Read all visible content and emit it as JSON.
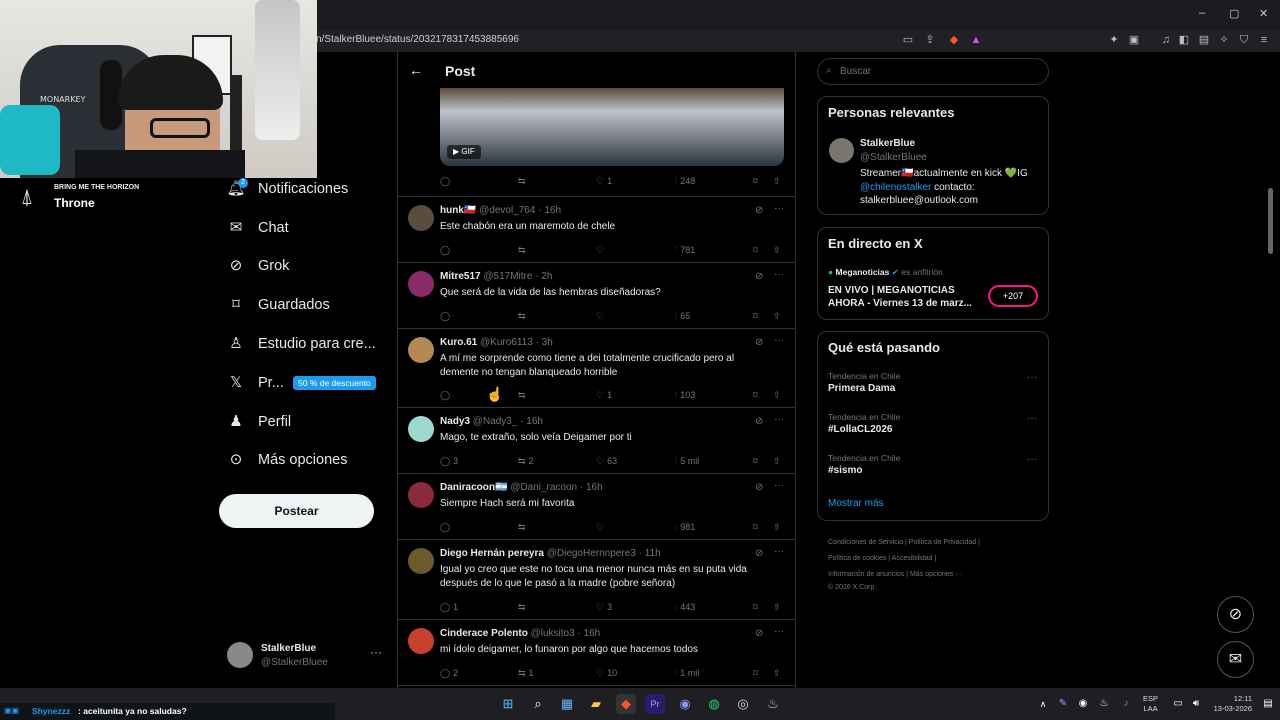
{
  "browser": {
    "url": "n/StalkerBluee/status/2032178317453885696",
    "minimize": "–",
    "maximize": "▢",
    "close": "✕"
  },
  "stream": {
    "band": "BRING ME THE HORIZON",
    "song": "Throne",
    "chair_brand": "MONARKEY",
    "chat_user": "Shynezzz",
    "chat_message": ": aceitunita ya no saludas?"
  },
  "nav": {
    "notifications": "Notificaciones",
    "notifications_badge": "2",
    "chat": "Chat",
    "grok": "Grok",
    "saved": "Guardados",
    "studio": "Estudio para cre...",
    "premium": "Pr...",
    "premium_promo": "50 % de descuento",
    "profile": "Perfil",
    "more": "Más opciones",
    "post_button": "Postear",
    "me_name": "StalkerBlue",
    "me_handle": "@StalkerBluee"
  },
  "post": {
    "header": "Post",
    "gif_label": "GIF",
    "main_actions": {
      "reply": "",
      "retweet": "",
      "like": "1",
      "views": "248"
    },
    "replies": [
      {
        "name": "hunk🇨🇱",
        "handle": "@devol_764",
        "time": "· 16h",
        "text": "Este chabón era un maremoto de chele",
        "reply": "",
        "rt": "",
        "like": "",
        "views": "781",
        "color": "#5b4d3c"
      },
      {
        "name": "Mitre517",
        "handle": "@517Mitre",
        "time": "· 2h",
        "text": "Que será de la vida de las hembras diseñadoras?",
        "reply": "",
        "rt": "",
        "like": "",
        "views": "65",
        "color": "#8a2b6b"
      },
      {
        "name": "Kuro.61",
        "handle": "@Kuro6113",
        "time": "· 3h",
        "text": "A mí me sorprende como tiene a dei totalmente crucificado pero al demente no tengan blanqueado horrible",
        "reply": "",
        "rt": "",
        "like": "1",
        "views": "103",
        "color": "#b58a52"
      },
      {
        "name": "Nady3",
        "handle": "@Nady3_",
        "time": "· 16h",
        "text": "Mago, te extraño, solo veía Deigamer por ti",
        "reply": "3",
        "rt": "2",
        "like": "63",
        "views": "5 mil",
        "color": "#9ad8d0"
      },
      {
        "name": "Daniracoon🇦🇷",
        "handle": "@Dani_racoon",
        "time": "· 16h",
        "text": "Siempre Hach será mi favorita",
        "reply": "",
        "rt": "",
        "like": "",
        "views": "981",
        "color": "#8b2a3a"
      },
      {
        "name": "Diego Hernán pereyra",
        "handle": "@DiegoHernnpere3",
        "time": "· 11h",
        "text": "Igual yo creo que este no toca una menor nunca más en su puta vida después de lo que le pasó a la madre (pobre señora)",
        "reply": "1",
        "rt": "",
        "like": "3",
        "views": "443",
        "color": "#6d5a2a"
      },
      {
        "name": "Cinderace Polento",
        "handle": "@luksito3",
        "time": "· 16h",
        "text": "mi ídolo deigamer, lo funaron por algo que hacemos todos",
        "reply": "2",
        "rt": "1",
        "like": "10",
        "views": "1 mil",
        "color": "#c8412e"
      }
    ]
  },
  "right": {
    "search_placeholder": "Buscar",
    "relevant_title": "Personas relevantes",
    "relevant_name": "StalkerBlue",
    "relevant_handle": "@StalkerBluee",
    "relevant_bio_1": "Streamer🇨🇱actualmente en kick 💚IG ",
    "relevant_bio_link": "@chilenostalker",
    "relevant_bio_2": " contacto: stalkerbluee@outlook.com",
    "live_title": "En directo en X",
    "live_host": "Meganoticias",
    "live_host_role": "es anfitrión",
    "live_text": "EN VIVO | MEGANOTICIAS AHORA - Viernes 13 de marz...",
    "live_count": "+207",
    "trends_title": "Qué está pasando",
    "trends": [
      {
        "cat": "Tendencia en Chile",
        "name": "Primera Dama"
      },
      {
        "cat": "Tendencia en Chile",
        "name": "#LollaCL2026"
      },
      {
        "cat": "Tendencia en Chile",
        "name": "#sismo"
      }
    ],
    "show_more": "Mostrar más",
    "footer_1": "Condiciones de Servicio  |  Política de Privacidad  |",
    "footer_2": "Política de cookies  |  Accesibilidad  |",
    "footer_3": "Información de anuncios  |  Más opciones ···",
    "footer_4": "© 2026 X Corp."
  },
  "taskbar": {
    "lang_1": "ESP",
    "lang_2": "LAA",
    "time": "12:11",
    "date": "13-03-2026"
  }
}
